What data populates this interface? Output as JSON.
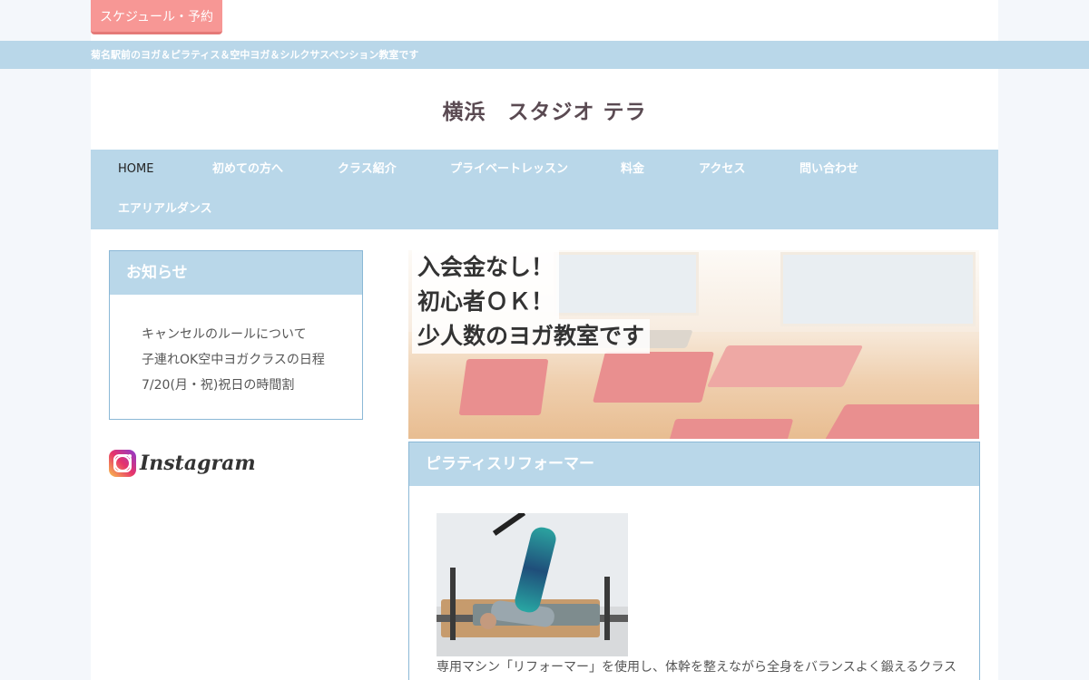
{
  "top": {
    "schedule_button": "スケジュール・予約"
  },
  "tagline": "菊名駅前のヨガ＆ピラティス＆空中ヨガ＆シルクサスペンション教室です",
  "site_title": "横浜　スタジオ テラ",
  "nav": {
    "items": [
      {
        "label": "HOME"
      },
      {
        "label": "初めての方へ"
      },
      {
        "label": "クラス紹介"
      },
      {
        "label": "プライベートレッスン"
      },
      {
        "label": "料金"
      },
      {
        "label": "アクセス"
      },
      {
        "label": "問い合わせ"
      },
      {
        "label": "エアリアルダンス"
      }
    ]
  },
  "news": {
    "title": "お知らせ",
    "items": [
      {
        "label": "キャンセルのルールについて"
      },
      {
        "label": "子連れOK空中ヨガクラスの日程"
      },
      {
        "label": "7/20(月・祝)祝日の時間割"
      }
    ]
  },
  "instagram": {
    "label": "Instagram"
  },
  "hero": {
    "lines": [
      "入会金なし！",
      "初心者ＯＫ！",
      "少人数のヨガ教室です"
    ]
  },
  "pilates": {
    "title": "ピラティスリフォーマー",
    "description": "専用マシン「リフォーマー」を使用し、体幹を整えながら全身をバランスよく鍛えるクラスです。"
  },
  "colors": {
    "accent_blue": "#b9d7e9",
    "button_pink": "#f79795",
    "title_text": "#5a4a52"
  }
}
